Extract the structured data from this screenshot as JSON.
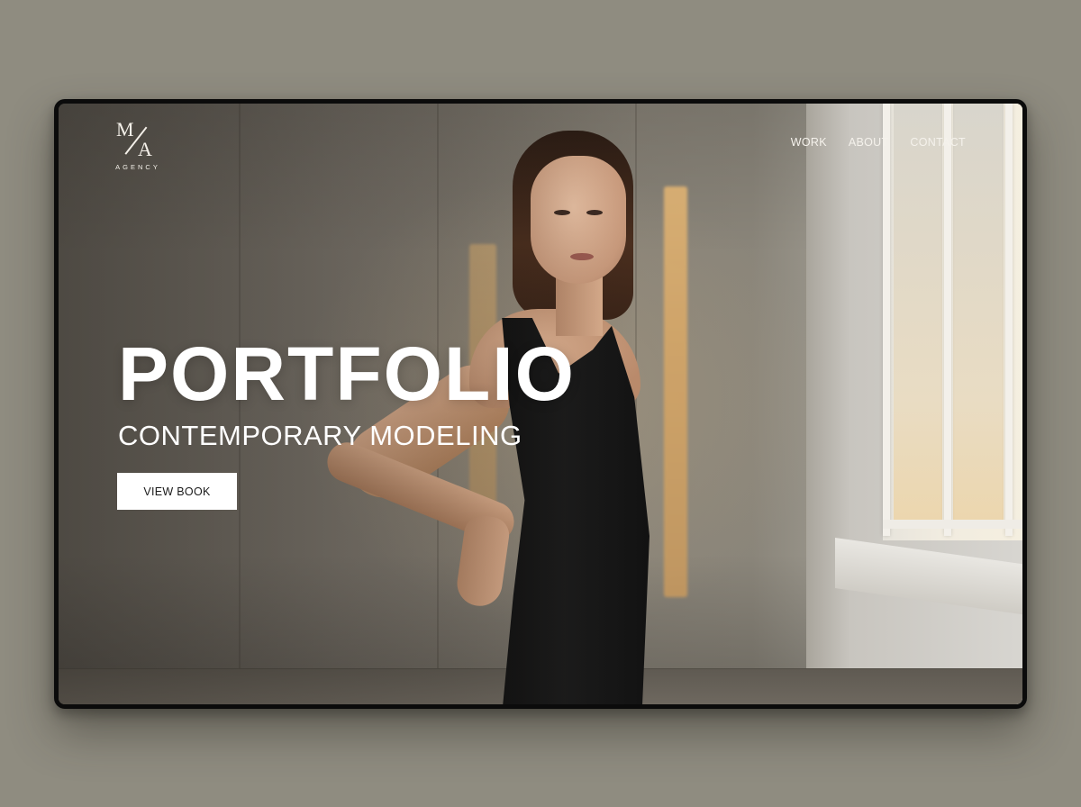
{
  "brand": {
    "mark_left": "M",
    "mark_right": "A",
    "wordmark": "AGENCY"
  },
  "nav": {
    "items": [
      {
        "label": "WORK"
      },
      {
        "label": "ABOUT"
      },
      {
        "label": "CONTACT"
      }
    ]
  },
  "hero": {
    "title": "PORTFOLIO",
    "subtitle": "CONTEMPORARY MODELING",
    "cta_label": "VIEW BOOK"
  },
  "colors": {
    "page_background": "#8f8c80",
    "device_frame": "#0b0b0b",
    "hero_text": "#ffffff",
    "cta_background": "#ffffff",
    "cta_text": "#1a1a1a"
  }
}
